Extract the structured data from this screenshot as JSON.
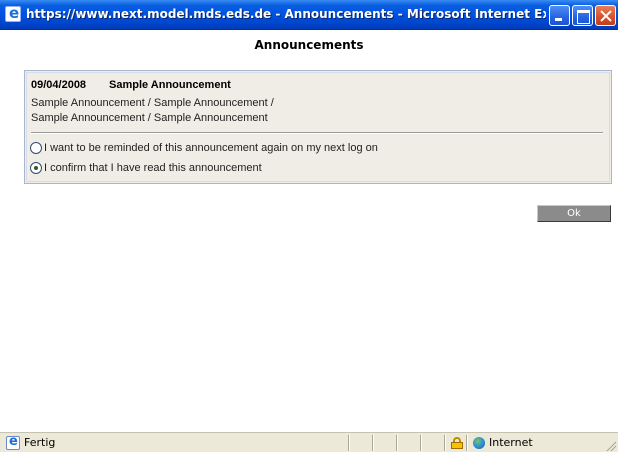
{
  "window": {
    "title": "https://www.next.model.mds.eds.de - Announcements - Microsoft Internet Explorer pro...",
    "icon": "ie-icon",
    "controls": [
      "minimize",
      "maximize",
      "close"
    ]
  },
  "page": {
    "title": "Announcements"
  },
  "announcement": {
    "date": "09/04/2008",
    "title": "Sample Announcement",
    "body_line1": "Sample Announcement / Sample Announcement /",
    "body_line2": "Sample Announcement / Sample Announcement"
  },
  "options": [
    {
      "label": "I want to be reminded of this announcement again on my next log on",
      "checked": false
    },
    {
      "label": "I confirm that I have read this announcement",
      "checked": true
    }
  ],
  "ok_button": {
    "label": "Ok"
  },
  "statusbar": {
    "status": "Fertig",
    "zone": "Internet",
    "icons": [
      "page-icon",
      "lock-icon",
      "globe-icon"
    ]
  }
}
